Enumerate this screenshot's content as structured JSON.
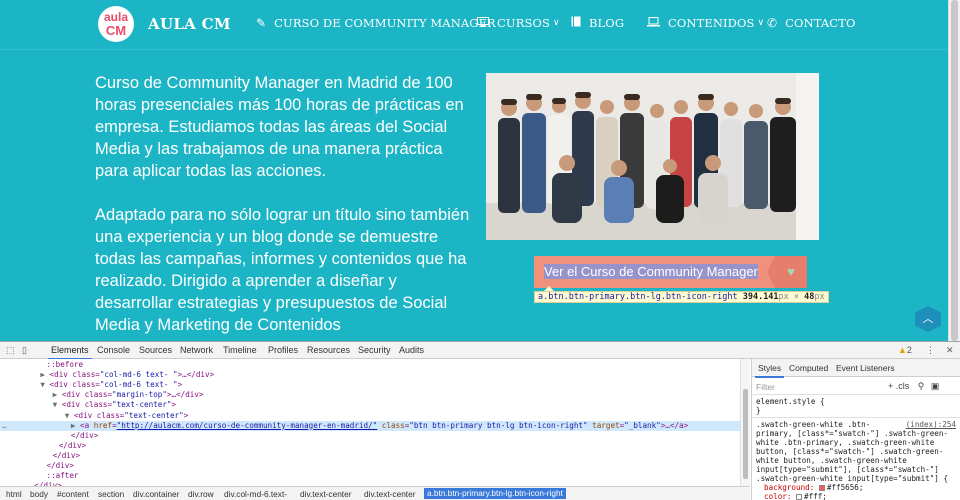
{
  "nav": {
    "logo_line1": "aula",
    "logo_line2": "CM",
    "brand": "AULA CM",
    "items": [
      {
        "label": "CURSO DE COMMUNITY MANAGER",
        "icon": "pencil-icon"
      },
      {
        "label": "CURSOS",
        "icon": "monitor-icon",
        "caret": "∨"
      },
      {
        "label": "BLOG",
        "icon": "book-icon"
      },
      {
        "label": "CONTENIDOS",
        "icon": "laptop-icon",
        "caret": "∨"
      },
      {
        "label": "CONTACTO",
        "icon": "phone-icon"
      }
    ]
  },
  "content": {
    "paragraph1": "Curso de Community Manager en Madrid  de 100 horas presenciales más 100 horas de prácticas en empresa. Estudiamos todas las áreas del Social Media y las trabajamos de una manera práctica para aplicar todas las acciones.",
    "paragraph2": "Adaptado para no sólo lograr un título sino también una experiencia y un blog donde se demuestre todas las campañas, informes y contenidos que ha realizado. Dirigido a aprender a diseñar y desarrollar estrategias y presupuestos de Social Media y Marketing de Contenidos",
    "cta_label": "Ver el Curso de Community Manager",
    "cta_icon": "heart-icon",
    "tooltip_selector": "a.btn.btn-primary.btn-lg.btn-icon-right",
    "tooltip_w": "394.141",
    "tooltip_x": " × ",
    "tooltip_h": "48",
    "tooltip_unit": "px",
    "scroll_top_icon": "chevron-up-icon"
  },
  "colors": {
    "page_bg": "#1cb5c5",
    "cta_bg": "#f0917d",
    "accent": "#3879d9"
  },
  "devtools": {
    "tabs": [
      "Elements",
      "Console",
      "Sources",
      "Network",
      "Timeline",
      "Profiles",
      "Resources",
      "Security",
      "Audits"
    ],
    "active_tab": "Elements",
    "warning_count": "2",
    "dom_lines": [
      {
        "indent": 5,
        "text": "::before",
        "kind": "pseudo"
      },
      {
        "indent": 4,
        "arrow": "▶",
        "open": "<div class=",
        "val": "\"col-md-6  text- \"",
        "close": ">…</div>"
      },
      {
        "indent": 4,
        "arrow": "▼",
        "open": "<div class=",
        "val": "\"col-md-6  text- \"",
        "close": ">"
      },
      {
        "indent": 6,
        "arrow": "▶",
        "open": "<div class=",
        "val": "\"margin-top\"",
        "close": ">…</div>"
      },
      {
        "indent": 6,
        "arrow": "▼",
        "open": "<div class=",
        "val": "\"text-center\"",
        "close": ">"
      },
      {
        "indent": 8,
        "arrow": "▼",
        "open": "<div class=",
        "val": "\"text-center\"",
        "close": ">"
      },
      {
        "indent": 9,
        "arrow": "▶",
        "selected": true,
        "href": "http://aulacm.com/curso-de-community-manager-en-madrid/",
        "classval": "\"btn btn-primary btn-lg  btn-icon-right\"",
        "target": "\"_blank\""
      },
      {
        "indent": 9,
        "text": "</div>",
        "kind": "tag"
      },
      {
        "indent": 7,
        "text": "</div>",
        "kind": "tag"
      },
      {
        "indent": 6,
        "text": "</div>",
        "kind": "tag"
      },
      {
        "indent": 5,
        "text": "</div>",
        "kind": "tag"
      },
      {
        "indent": 5,
        "text": "::after",
        "kind": "pseudo"
      },
      {
        "indent": 3,
        "text": "</div>",
        "kind": "tag"
      },
      {
        "indent": 3,
        "text": "::after",
        "kind": "pseudo"
      }
    ],
    "breadcrumbs": [
      "html",
      "body",
      "#content",
      "section",
      "div.container",
      "div.row",
      "div.col-md-6.text-",
      "div.text-center",
      "div.text-center",
      "a.btn.btn-primary.btn-lg.btn-icon-right"
    ],
    "styles_tabs": [
      "Styles",
      "Computed",
      "Event Listeners"
    ],
    "filter_placeholder": "Filter",
    "filter_tools": "+  .cls",
    "css": {
      "element_style": "element.style {",
      "close": "}",
      "rule_lines": [
        ".swatch-green-white .btn-",
        "primary, [class*=\"swatch-\"] .swatch-green-",
        "white .btn-primary, .swatch-green-white",
        "button, [class*=\"swatch-\"] .swatch-green-",
        "white button, .swatch-green-white",
        "input[type=\"submit\"], [class*=\"swatch-\"]",
        ".swatch-green-white input[type=\"submit\"] {"
      ],
      "source": "(index):254",
      "decl1_prop": "background:",
      "decl1_val": "#ff5656;",
      "decl2_prop": "color:",
      "decl2_val": "#fff;"
    }
  }
}
